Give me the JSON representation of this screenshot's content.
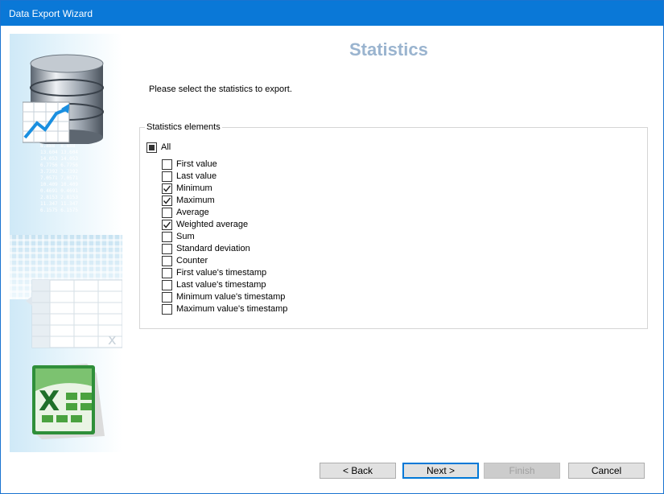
{
  "window": {
    "title": "Data Export Wizard"
  },
  "page": {
    "heading": "Statistics",
    "instruction": "Please select the statistics to export."
  },
  "banner": {
    "numbers": "8.888  8.888\n13.604 13.604\n14.053 14.053\n6.7756 6.7756\n3.7392 3.7392\n7.0571 7.0571\n10.409 10.409\n0.4691 0.4691\n2.8153 2.8153\n11.347 11.347\n6.1575 6.1575"
  },
  "statistics": {
    "group_label": "Statistics elements",
    "all": {
      "label": "All",
      "state": "partial"
    },
    "items": [
      {
        "label": "First value",
        "checked": false
      },
      {
        "label": "Last value",
        "checked": false
      },
      {
        "label": "Minimum",
        "checked": true
      },
      {
        "label": "Maximum",
        "checked": true
      },
      {
        "label": "Average",
        "checked": false
      },
      {
        "label": "Weighted average",
        "checked": true
      },
      {
        "label": "Sum",
        "checked": false
      },
      {
        "label": "Standard deviation",
        "checked": false
      },
      {
        "label": "Counter",
        "checked": false
      },
      {
        "label": "First value's timestamp",
        "checked": false
      },
      {
        "label": "Last value's timestamp",
        "checked": false
      },
      {
        "label": "Minimum value's timestamp",
        "checked": false
      },
      {
        "label": "Maximum value's timestamp",
        "checked": false
      }
    ]
  },
  "buttons": {
    "back": "< Back",
    "next": "Next >",
    "finish": "Finish",
    "cancel": "Cancel"
  },
  "colors": {
    "titlebar": "#0a78d7",
    "heading": "#9ab4cf",
    "default_button_border": "#0078d7"
  }
}
